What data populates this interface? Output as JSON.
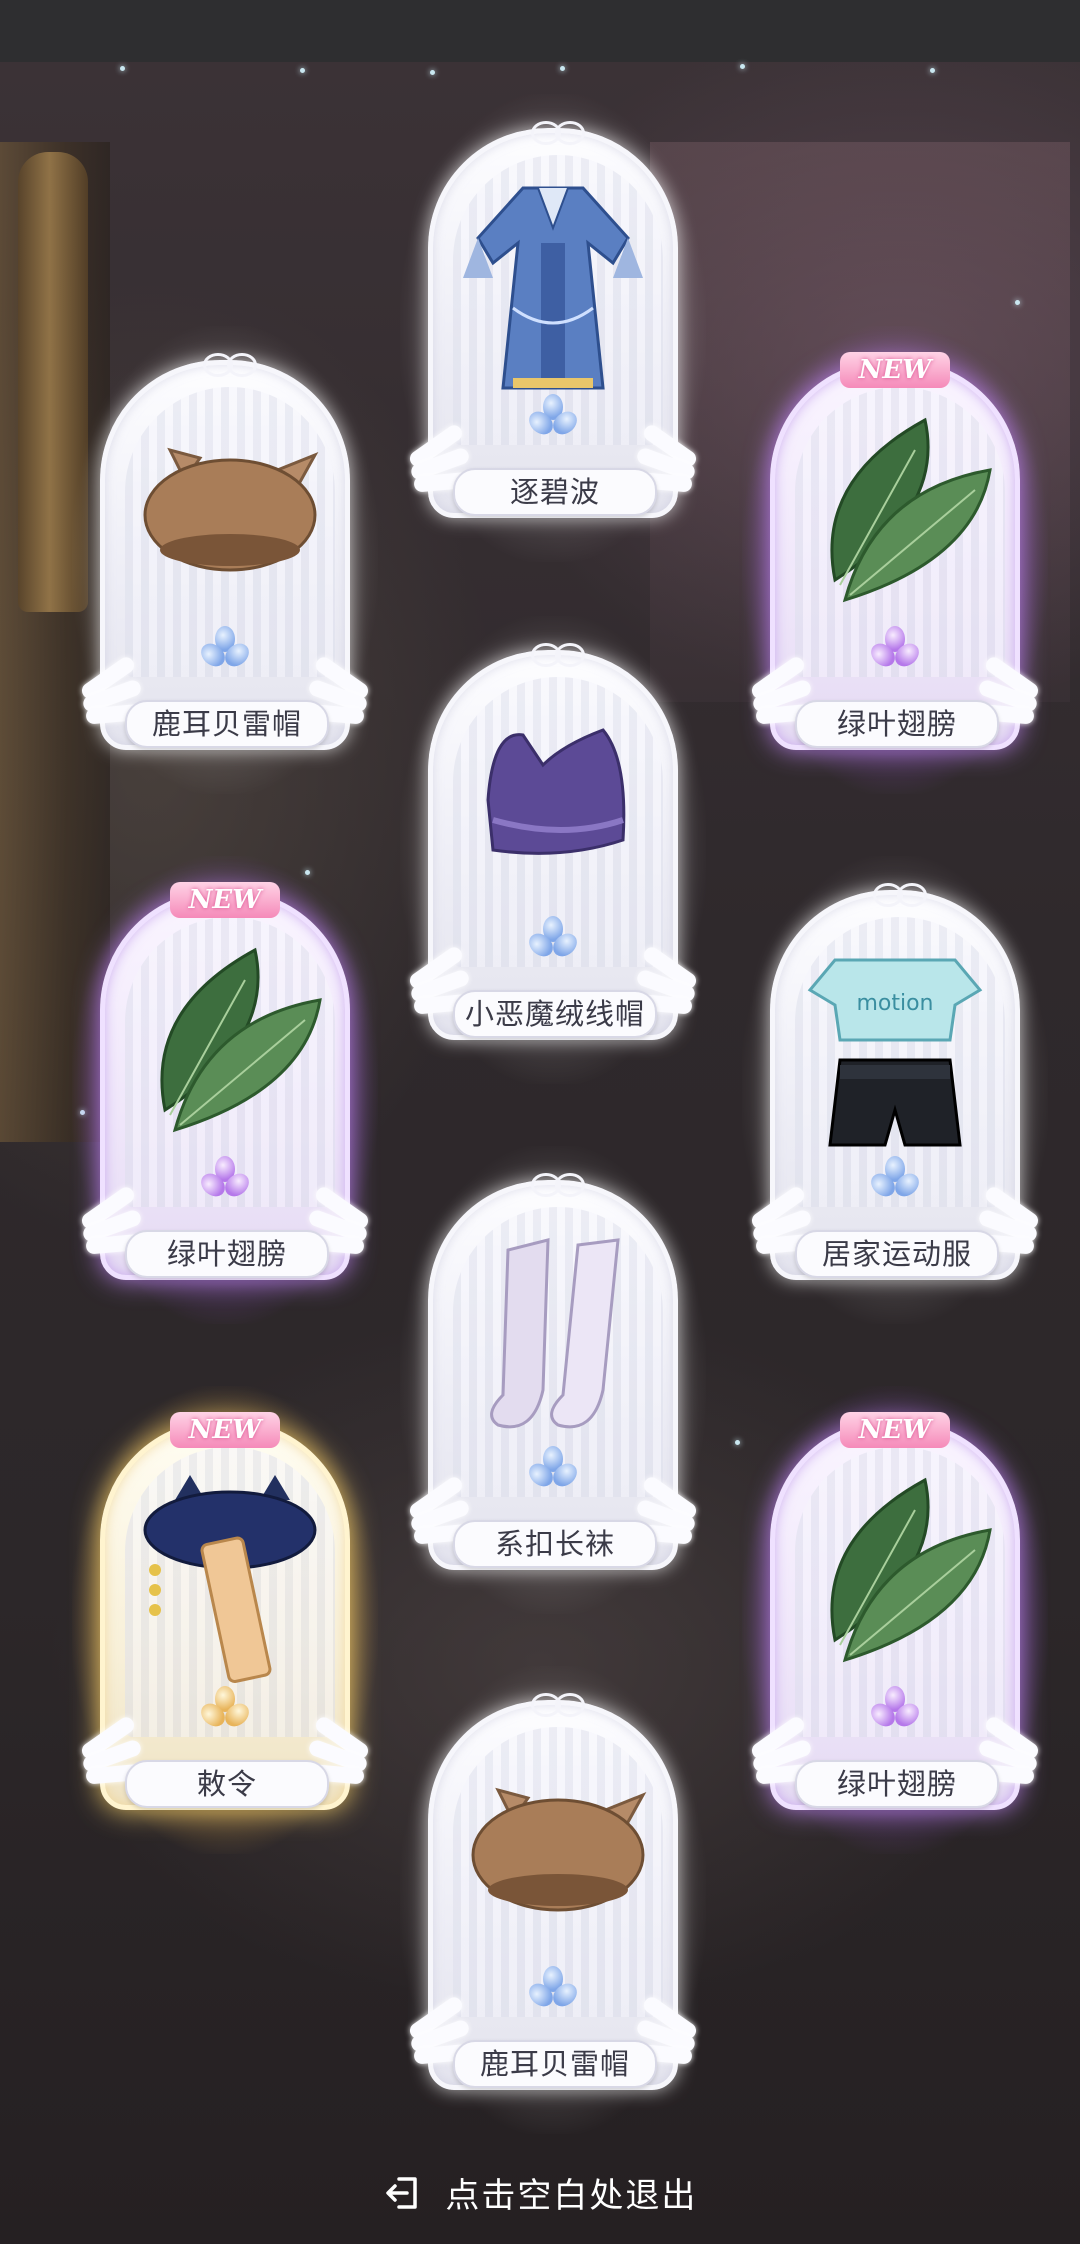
{
  "footer": {
    "exit_text": "点击空白处退出",
    "exit_icon": "exit-icon"
  },
  "badge_text": "NEW",
  "colors": {
    "normal_frame": "#fdfdff",
    "purple_glow": "#b578ea",
    "gold_glow": "#e8b45a",
    "label_text": "#3b3b48"
  },
  "cards": [
    {
      "name": "逐碧波",
      "rarity": "normal",
      "new": false,
      "item": "blue-hanfu-dress"
    },
    {
      "name": "鹿耳贝雷帽",
      "rarity": "normal",
      "new": false,
      "item": "deer-ear-beret"
    },
    {
      "name": "绿叶翅膀",
      "rarity": "purple",
      "new": true,
      "item": "green-leaf-wings"
    },
    {
      "name": "小恶魔绒线帽",
      "rarity": "normal",
      "new": false,
      "item": "purple-knit-hat"
    },
    {
      "name": "绿叶翅膀",
      "rarity": "purple",
      "new": true,
      "item": "green-leaf-wings"
    },
    {
      "name": "居家运动服",
      "rarity": "normal",
      "new": false,
      "item": "home-sportswear"
    },
    {
      "name": "系扣长袜",
      "rarity": "normal",
      "new": false,
      "item": "buttoned-stockings"
    },
    {
      "name": "敕令",
      "rarity": "gold",
      "new": true,
      "item": "cat-ear-jiangshi-hat"
    },
    {
      "name": "绿叶翅膀",
      "rarity": "purple",
      "new": true,
      "item": "green-leaf-wings"
    },
    {
      "name": "鹿耳贝雷帽",
      "rarity": "normal",
      "new": false,
      "item": "deer-ear-beret"
    }
  ]
}
